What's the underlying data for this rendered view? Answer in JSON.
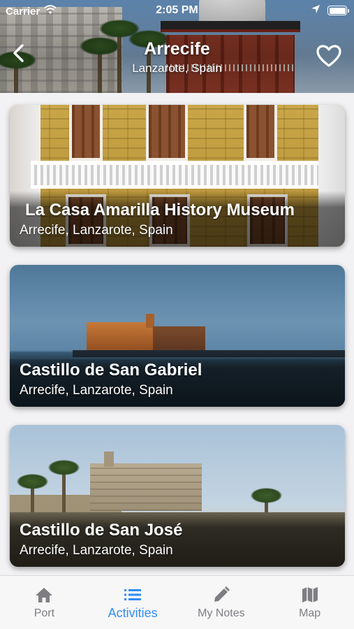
{
  "status_bar": {
    "carrier": "Carrier",
    "time": "2:05 PM"
  },
  "header": {
    "title": "Arrecife",
    "subtitle": "Lanzarote, Spain",
    "back_icon": "chevron-left-icon",
    "favorite_icon": "heart-outline-icon"
  },
  "cards": [
    {
      "title": "La Casa Amarilla History Museum",
      "location": "Arrecife, Lanzarote, Spain"
    },
    {
      "title": "Castillo de San Gabriel",
      "location": "Arrecife, Lanzarote, Spain"
    },
    {
      "title": "Castillo de San José",
      "location": "Arrecife, Lanzarote, Spain"
    }
  ],
  "tabs": [
    {
      "label": "Port",
      "icon": "home-icon",
      "active": false
    },
    {
      "label": "Activities",
      "icon": "list-icon",
      "active": true
    },
    {
      "label": "My Notes",
      "icon": "pencil-icon",
      "active": false
    },
    {
      "label": "Map",
      "icon": "map-icon",
      "active": false
    }
  ],
  "colors": {
    "accent": "#2f8cf4",
    "tab_inactive": "#7d7d82",
    "background": "#f2f2f4"
  }
}
